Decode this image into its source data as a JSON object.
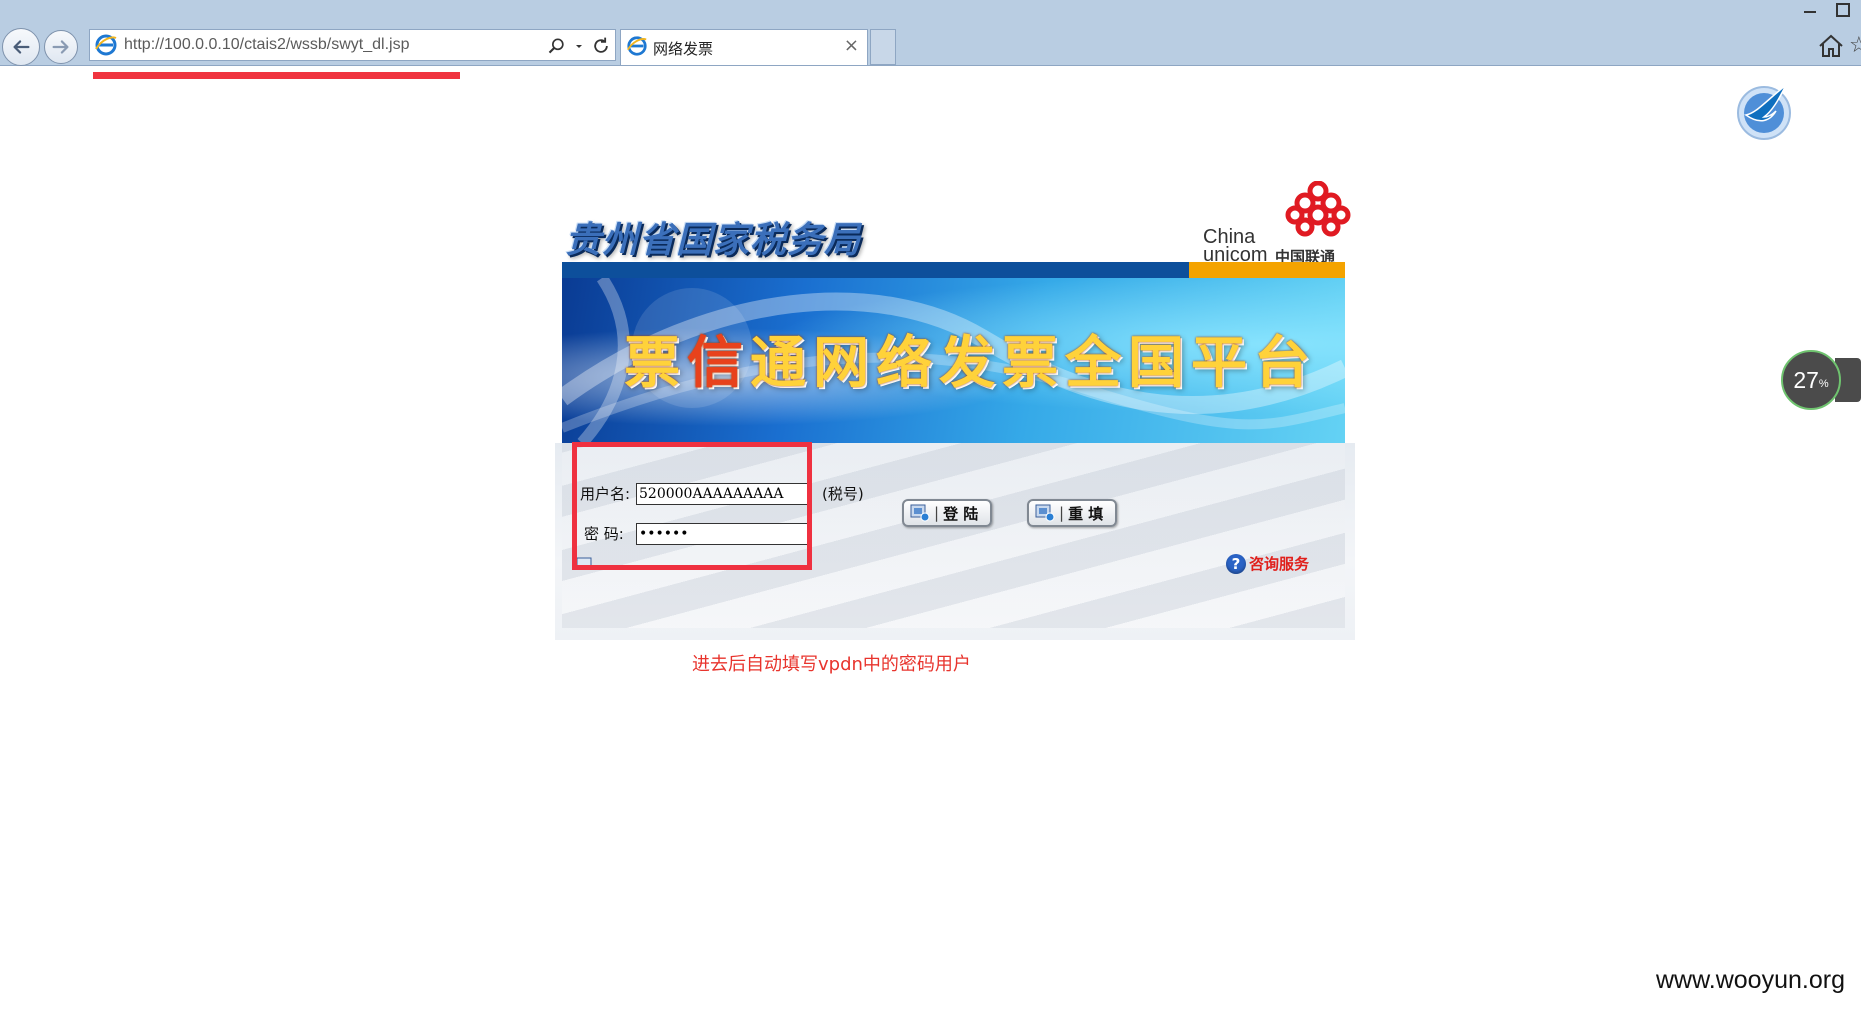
{
  "browser": {
    "url": "http://100.0.0.10/ctais2/wssb/swyt_dl.jsp",
    "tab_title": "网络发票",
    "tab_close": "×"
  },
  "header": {
    "bureau_title": "贵州省国家税务局",
    "logo": {
      "line1": "China",
      "line2": "unicom",
      "cn": "中国联通"
    }
  },
  "banner": {
    "title_part1": "票",
    "title_highlight": "信",
    "title_part2": "通网络发票全国平台"
  },
  "login_form": {
    "username_label": "用户名:",
    "username_value": "520000AAAAAAAAA",
    "taxid_note": "(税号)",
    "password_label": "密 码:",
    "password_value": "123456",
    "login_button": "登 陆",
    "reset_button": "重 填",
    "help_link": "咨询服务"
  },
  "annotation": "进去后自动填写vpdn中的密码用户",
  "speed_widget": {
    "value": "27",
    "unit": "%"
  },
  "watermark": "www.wooyun.org",
  "colors": {
    "annotation_red": "#ef3140",
    "chrome_blue": "#b9cde2",
    "header_blue": "#0d4f9b",
    "header_orange": "#f4a300"
  }
}
